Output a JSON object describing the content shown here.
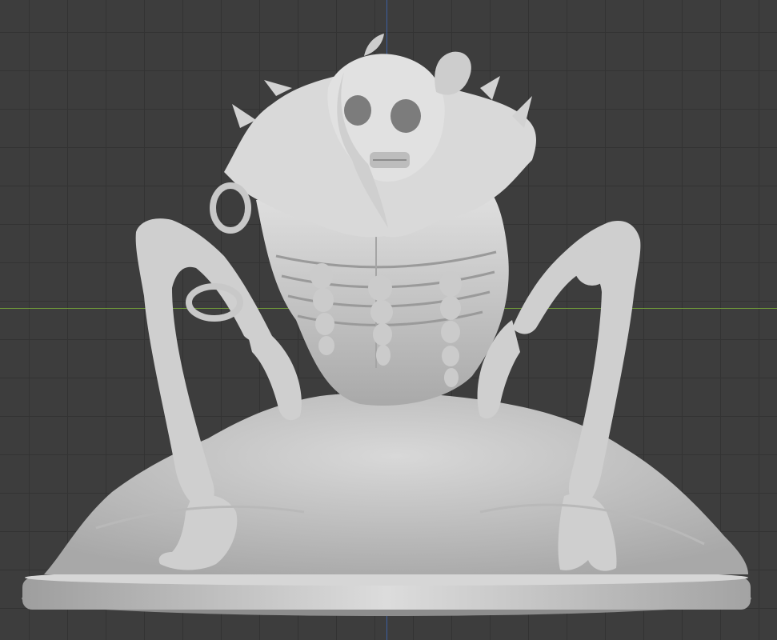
{
  "viewport": {
    "mode": "3d-sculpt-view",
    "grid": true,
    "colors": {
      "background": "#3d3d3d",
      "grid_line": "#333333",
      "x_axis": "#6f9a3a",
      "z_axis": "#3b5fa0",
      "model_clay": "#cfcfcf"
    }
  },
  "model": {
    "icon": "skeletal-creature-miniature",
    "material": "matcap-clay"
  }
}
